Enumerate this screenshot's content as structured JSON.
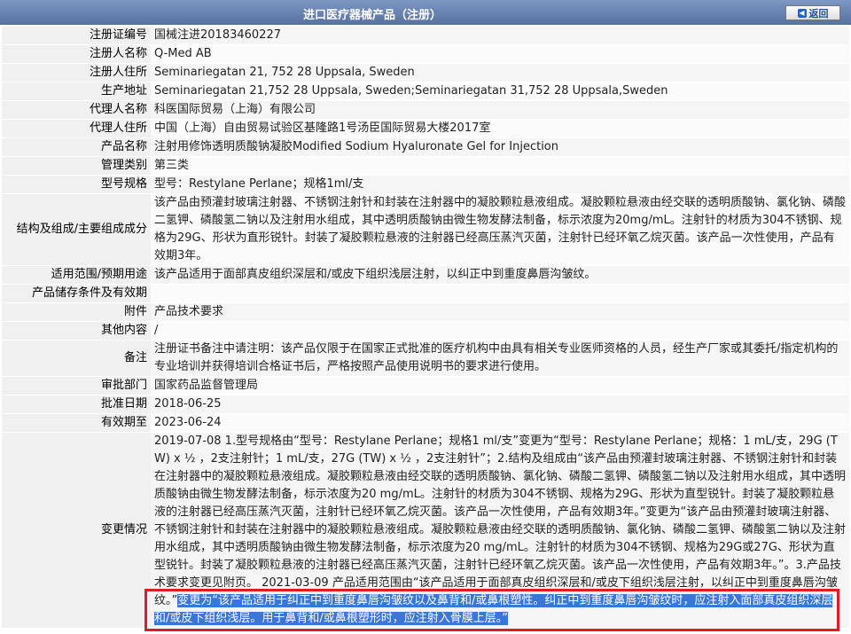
{
  "header": {
    "title": "进口医疗器械产品（注册）",
    "back_label": "返回"
  },
  "rows": [
    {
      "label": "注册证编号",
      "value": "国械注进20183460227"
    },
    {
      "label": "注册人名称",
      "value": "Q-Med AB"
    },
    {
      "label": "注册人住所",
      "value": "Seminariegatan 21, 752 28 Uppsala, Sweden"
    },
    {
      "label": "生产地址",
      "value": "Seminariegatan 21,752 28 Uppsala, Sweden;Seminariegatan 31,752 28 Uppsala,Sweden"
    },
    {
      "label": "代理人名称",
      "value": "科医国际贸易（上海）有限公司"
    },
    {
      "label": "代理人住所",
      "value": "中国（上海）自由贸易试验区基隆路1号汤臣国际贸易大楼2017室"
    },
    {
      "label": "产品名称",
      "value": "注射用修饰透明质酸钠凝胶Modified Sodium Hyaluronate Gel for Injection"
    },
    {
      "label": "管理类别",
      "value": "第三类"
    },
    {
      "label": "型号规格",
      "value": "型号：Restylane Perlane；规格1ml/支"
    },
    {
      "label": "结构及组成/主要组成成分",
      "value": "该产品由预灌封玻璃注射器、不锈钢注射针和封装在注射器中的凝胶颗粒悬液组成。凝胶颗粒悬液由经交联的透明质酸钠、氯化钠、磷酸二氢钾、磷酸氢二钠以及注射用水组成，其中透明质酸钠由微生物发酵法制备，标示浓度为20mg/mL。注射针的材质为304不锈钢、规格为29G、形状为直形锐针。封装了凝胶颗粒悬液的注射器已经高压蒸汽灭菌，注射针已经环氧乙烷灭菌。该产品一次性使用，产品有效期3年。"
    },
    {
      "label": "适用范围/预期用途",
      "value": "该产品适用于面部真皮组织深层和/或皮下组织浅层注射，以纠正中到重度鼻唇沟皱纹。"
    },
    {
      "label": "产品储存条件及有效期",
      "value": ""
    },
    {
      "label": "附件",
      "value": "产品技术要求"
    },
    {
      "label": "其他内容",
      "value": "/"
    },
    {
      "label": "备注",
      "value": "注册证书备注中请注明：该产品仅限于在国家正式批准的医疗机构中由具有相关专业医师资格的人员，经生产厂家或其委托/指定机构的专业培训并获得培训合格证书后，严格按照产品使用说明书的要求进行使用。"
    },
    {
      "label": "审批部门",
      "value": "国家药品监督管理局"
    },
    {
      "label": "批准日期",
      "value": "2018-06-25"
    },
    {
      "label": "有效期至",
      "value": "2023-06-24"
    }
  ],
  "changes": {
    "label": "变更情况",
    "text_plain": "2019-07-08 1.型号规格由“型号：Restylane Perlane；规格1 ml/支”变更为“型号：Restylane Perlane；规格：1 mL/支，29G (TW) x ½ ，2支注射针；1 mL/支，27G (TW) x ½ ，2支注射针”；2.结构及组成由“该产品由预灌封玻璃注射器、不锈钢注射针和封装在注射器中的凝胶颗粒悬液组成。凝胶颗粒悬液由经交联的透明质酸钠、氯化钠、磷酸二氢钾、磷酸氢二钠以及注射用水组成，其中透明质酸钠由微生物发酵法制备，标示浓度为20 mg/mL。注射针的材质为304不锈钢、规格为29G、形状为直型锐针。封装了凝胶颗粒悬液的注射器已经高压蒸汽灭菌，注射针已经环氧乙烷灭菌。该产品一次性使用，产品有效期3年。”变更为“该产品由预灌封玻璃注射器、不锈钢注射针和封装在注射器中的凝胶颗粒悬液组成。凝胶颗粒悬液由经交联的透明质酸钠、氯化钠、磷酸二氢钾、磷酸氢二钠以及注射用水组成，其中透明质酸钠由微生物发酵法制备，标示浓度为20 mg/mL。注射针的材质为304不锈钢、规格为29G或27G、形状为直型锐针。封装了凝胶颗粒悬液的注射器已经高压蒸汽灭菌，注射针已经环氧乙烷灭菌。该产品一次性使用，产品有效期3年。”。3.产品技术要求变更见附页。 2021-03-09 产品适用范围由“该产品适用于面部真皮组织深层和/或皮下组织浅层注射，以纠正中到重度鼻唇沟皱纹。”",
    "text_highlight": "变更为“该产品适用于纠正中到重度鼻唇沟皱纹以及鼻背和/或鼻根塑性。纠正中到重度鼻唇沟皱纹时，应注射入面部真皮组织深层和/或皮下组织浅层。用于鼻背和/或鼻根塑形时，应注射入骨膜上层。”"
  }
}
